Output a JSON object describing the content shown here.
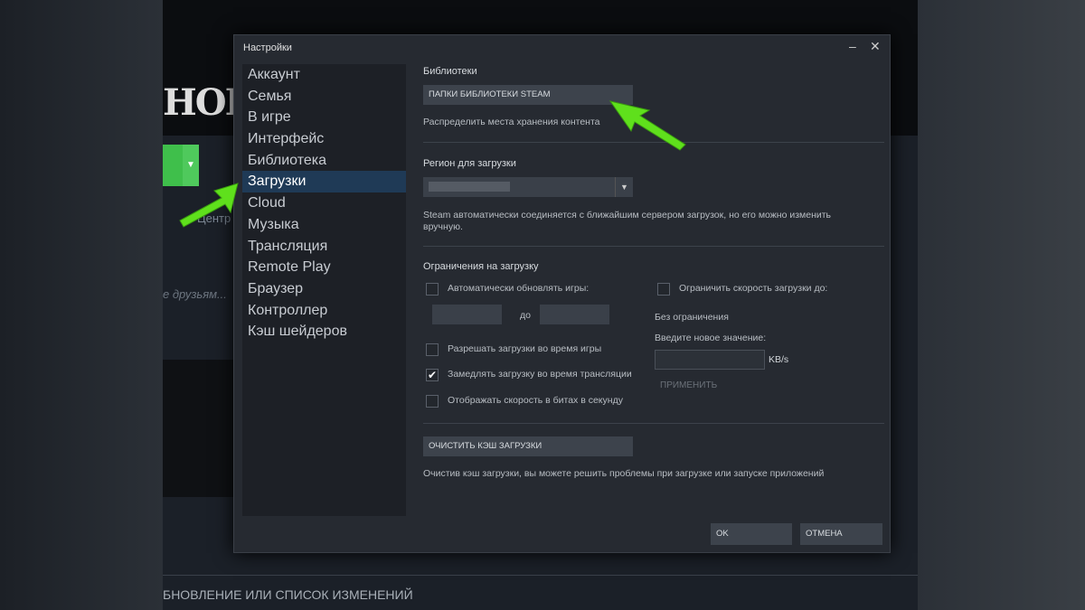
{
  "background": {
    "logo": "HOBIA",
    "nav_item": "Центр",
    "friends_hint": "е друзьям...",
    "changes_heading": "БНОВЛЕНИЕ ИЛИ СПИСОК ИЗМЕНЕНИЙ"
  },
  "dialog": {
    "title": "Настройки",
    "nav": [
      "Аккаунт",
      "Семья",
      "В игре",
      "Интерфейс",
      "Библиотека",
      "Загрузки",
      "Cloud",
      "Музыка",
      "Трансляция",
      "Remote Play",
      "Браузер",
      "Контроллер",
      "Кэш шейдеров"
    ],
    "active_nav": "Загрузки",
    "libraries": {
      "heading": "Библиотеки",
      "button": "ПАПКИ БИБЛИОТЕКИ STEAM",
      "desc": "Распределить места хранения контента"
    },
    "region": {
      "heading": "Регион для загрузки",
      "desc": "Steam автоматически соединяется с ближайшим сервером загрузок, но его можно изменить вручную."
    },
    "limits": {
      "heading": "Ограничения на загрузку",
      "auto_update": "Автоматически обновлять игры:",
      "to": "до",
      "allow_during_game": "Разрешать загрузки во время игры",
      "throttle_broadcast": "Замедлять загрузку во время трансляции",
      "bits_per_second": "Отображать скорость в битах в секунду",
      "limit_speed": "Ограничить скорость загрузки до:",
      "no_limit": "Без ограничения",
      "enter_value": "Введите новое значение:",
      "unit": "KB/s",
      "apply": "ПРИМЕНИТЬ",
      "throttle_checked": true
    },
    "cache": {
      "button": "ОЧИСТИТЬ КЭШ ЗАГРУЗКИ",
      "desc": "Очистив кэш загрузки, вы можете решить проблемы при загрузке или запуске приложений"
    },
    "ok": "OK",
    "cancel": "ОТМЕНА"
  },
  "colors": {
    "accent_arrow": "#5fe01c",
    "active": "#1f3a56"
  }
}
